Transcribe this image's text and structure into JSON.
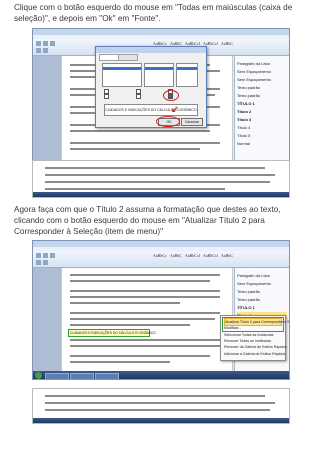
{
  "instructions": [
    "Clique com o botão esquerdo do mouse em \"Todas em maiúsculas (caixa de seleção)\", e depois em \"Ok\" em \"Fonte\".",
    "Agora faça com que o Título 2 assuma a formatação que destes ao texto, clicando com o botão esquerdo do mouse em \"Atualizar Título 2 para Corresponder à Seleção (item de menu)\""
  ],
  "screenshot_1": {
    "ribbon_labels": [
      "AaBbCc",
      "AaBbC",
      "AaBbCcI",
      "AaBbCcl",
      "AaBbC",
      "AaBbCc",
      "AaBbCcl"
    ],
    "styles_pane": [
      "Parágrafo da Lista",
      "Sem Espaçamento",
      "Sem Espaçamento",
      "Texto padrão",
      "Texto padrão",
      "TÍTULO 1",
      "Título 2",
      "Título 3",
      "Título 4",
      "Título 5",
      "Normal"
    ],
    "dialog": {
      "preview_text": "CUIDADOS E INDICAÇÕES DO CÁLCULO ECONÔMICO",
      "ok_label": "OK",
      "cancel_label": "Cancelar"
    }
  },
  "screenshot_2": {
    "highlighted_heading": "CUIDADOS E INDICAÇÕES DO CÁLCULO ECONÔMICO",
    "styles_pane": [
      "Parágrafo da Lista",
      "Sem Espaçamento",
      "Texto padrão",
      "Texto padrão",
      "TÍTULO 1",
      "Título 2",
      "Título 3"
    ],
    "context_menu": [
      "Atualizar Título 2 para Corresponder à Seleção",
      "Modificar...",
      "Selecionar Todas as Instâncias",
      "Remover Todas as Instâncias",
      "Remover da Galeria de Estilos Rápidos",
      "Adicionar à Galeria de Estilos Rápidos"
    ]
  },
  "colors": {
    "annotation_red": "#d82020",
    "annotation_green": "#2da12d"
  }
}
